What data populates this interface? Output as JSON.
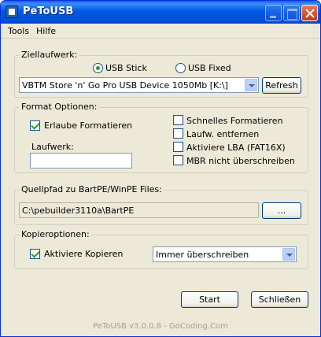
{
  "window": {
    "title": "PeToUSB"
  },
  "menu": [
    "Tools",
    "Hilfe"
  ],
  "ziellaufwerk": {
    "legend": "Ziellaufwerk:",
    "radio_usb_stick": "USB Stick",
    "radio_usb_fixed": "USB Fixed",
    "selected": "USB Stick",
    "device": "VBTM Store 'n' Go Pro USB Device 1050Mb [K:\\]",
    "refresh_label": "Refresh"
  },
  "format": {
    "legend": "Format Optionen:",
    "erlaube": "Erlaube Formatieren",
    "laufwerk_label": "Laufwerk:",
    "laufwerk_value": "",
    "schnelles": "Schnelles Formatieren",
    "laufw_entfernen": "Laufw. entfernen",
    "aktiviere_lba": "Aktiviere LBA (FAT16X)",
    "mbr": "MBR nicht überschreiben"
  },
  "quellpfad": {
    "legend": "Quellpfad zu BartPE/WinPE Files:",
    "path": "C:\\pebuilder3110a\\BartPE",
    "browse_label": "..."
  },
  "kopier": {
    "legend": "Kopieroptionen:",
    "aktiviere": "Aktiviere Kopieren",
    "mode": "Immer überschreiben"
  },
  "buttons": {
    "start": "Start",
    "close": "Schließen"
  },
  "footer": "PeToUSB v3.0.0.8 - GoCoding.Com"
}
